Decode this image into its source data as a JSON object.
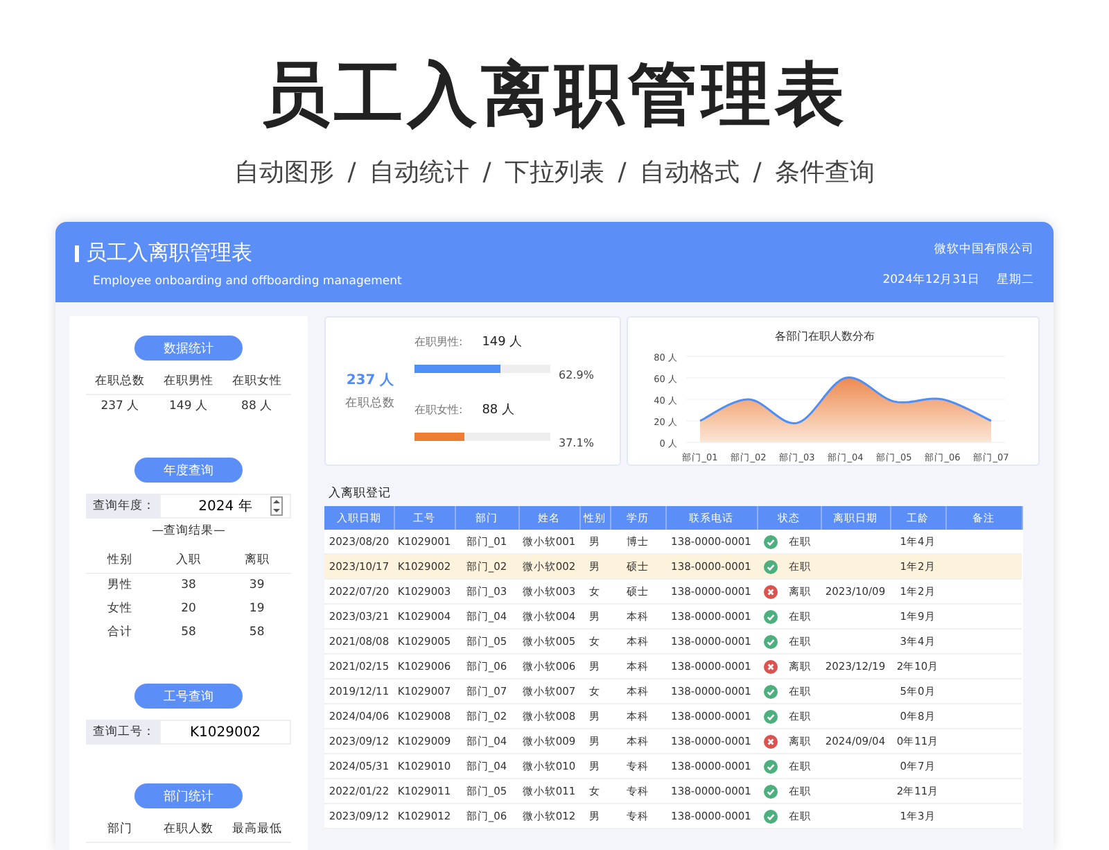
{
  "banner": {
    "title": "员工入离职管理表",
    "subtitle": "自动图形 / 自动统计 / 下拉列表 / 自动格式 / 条件查询"
  },
  "header": {
    "title": "员工入离职管理表",
    "subtitle": "Employee onboarding and offboarding management",
    "company": "微软中国有限公司",
    "date": "2024年12月31日",
    "weekday": "星期二"
  },
  "stats": {
    "button": "数据统计",
    "labels": [
      "在职总数",
      "在职男性",
      "在职女性"
    ],
    "values": [
      "237 人",
      "149 人",
      "88 人"
    ]
  },
  "year_query": {
    "button": "年度查询",
    "label": "查询年度：",
    "value": "2024 年",
    "result_title": "—查询结果—",
    "columns": [
      "性别",
      "入职",
      "离职"
    ],
    "rows": [
      [
        "男性",
        "38",
        "39"
      ],
      [
        "女性",
        "20",
        "19"
      ],
      [
        "合计",
        "58",
        "58"
      ]
    ]
  },
  "id_query": {
    "button": "工号查询",
    "label": "查询工号：",
    "value": "K1029002"
  },
  "dept_stats": {
    "button": "部门统计",
    "columns": [
      "部门",
      "在职人数",
      "最高最低"
    ]
  },
  "summary": {
    "total": "237 人",
    "total_label": "在职总数",
    "bars": [
      {
        "label": "在职男性:",
        "value": "149 人",
        "level": 0.629,
        "percent": "62.9%",
        "color": "#4f8ef7"
      },
      {
        "label": "在职女性:",
        "value": "88 人",
        "level": 0.371,
        "percent": "37.1%",
        "color": "#ed7d31"
      }
    ]
  },
  "chart": {
    "chart_data": {
      "type": "area",
      "title": "各部门在职人数分布",
      "categories": [
        "部门_01",
        "部门_02",
        "部门_03",
        "部门_04",
        "部门_05",
        "部门_06",
        "部门_07"
      ],
      "series": [
        {
          "color": "#4f8ef7",
          "values": [
            20,
            40,
            18,
            60,
            38,
            40,
            20
          ]
        }
      ],
      "grid": true,
      "ylim": [
        0,
        80
      ],
      "yticks": [
        {
          "value": 0,
          "label": "0 人"
        },
        {
          "value": 20,
          "label": "20 人"
        },
        {
          "value": 40,
          "label": "40 人"
        },
        {
          "value": 60,
          "label": "60 人"
        },
        {
          "value": 80,
          "label": "80 人"
        }
      ]
    }
  },
  "register": {
    "title": "入离职登记",
    "columns": [
      "入职日期",
      "工号",
      "部门",
      "姓名",
      "性别",
      "学历",
      "联系电话",
      "状态",
      "离职日期",
      "工龄",
      "备注"
    ],
    "rows": [
      {
        "selected": false,
        "resigned": false,
        "hired": "2023/08/20",
        "id": "K1029001",
        "dept": "部门_01",
        "name": "微小软001",
        "gender": "男",
        "education": "博士",
        "phone": "138-0000-0001",
        "status": "在职",
        "tenure": "1年4月"
      },
      {
        "selected": true,
        "resigned": false,
        "hired": "2023/10/17",
        "id": "K1029002",
        "dept": "部门_02",
        "name": "微小软002",
        "gender": "男",
        "education": "硕士",
        "phone": "138-0000-0001",
        "status": "在职",
        "tenure": "1年2月"
      },
      {
        "selected": false,
        "resigned": true,
        "hired": "2022/07/20",
        "id": "K1029003",
        "dept": "部门_03",
        "name": "微小软003",
        "gender": "女",
        "education": "硕士",
        "phone": "138-0000-0001",
        "status": "离职",
        "leave_date": "2023/10/09",
        "tenure": "1年2月"
      },
      {
        "selected": false,
        "resigned": false,
        "hired": "2023/03/21",
        "id": "K1029004",
        "dept": "部门_04",
        "name": "微小软004",
        "gender": "男",
        "education": "本科",
        "phone": "138-0000-0001",
        "status": "在职",
        "tenure": "1年9月"
      },
      {
        "selected": false,
        "resigned": false,
        "hired": "2021/08/08",
        "id": "K1029005",
        "dept": "部门_05",
        "name": "微小软005",
        "gender": "女",
        "education": "本科",
        "phone": "138-0000-0001",
        "status": "在职",
        "tenure": "3年4月"
      },
      {
        "selected": false,
        "resigned": true,
        "hired": "2021/02/15",
        "id": "K1029006",
        "dept": "部门_06",
        "name": "微小软006",
        "gender": "男",
        "education": "本科",
        "phone": "138-0000-0001",
        "status": "离职",
        "leave_date": "2023/12/19",
        "tenure": "2年10月"
      },
      {
        "selected": false,
        "resigned": false,
        "hired": "2019/12/11",
        "id": "K1029007",
        "dept": "部门_07",
        "name": "微小软007",
        "gender": "女",
        "education": "本科",
        "phone": "138-0000-0001",
        "status": "在职",
        "tenure": "5年0月"
      },
      {
        "selected": false,
        "resigned": false,
        "hired": "2024/04/06",
        "id": "K1029008",
        "dept": "部门_02",
        "name": "微小软008",
        "gender": "男",
        "education": "本科",
        "phone": "138-0000-0001",
        "status": "在职",
        "tenure": "0年8月"
      },
      {
        "selected": false,
        "resigned": true,
        "hired": "2023/09/12",
        "id": "K1029009",
        "dept": "部门_04",
        "name": "微小软009",
        "gender": "男",
        "education": "本科",
        "phone": "138-0000-0001",
        "status": "离职",
        "leave_date": "2024/09/04",
        "tenure": "0年11月"
      },
      {
        "selected": false,
        "resigned": false,
        "hired": "2024/05/31",
        "id": "K1029010",
        "dept": "部门_04",
        "name": "微小软010",
        "gender": "男",
        "education": "专科",
        "phone": "138-0000-0001",
        "status": "在职",
        "tenure": "0年7月"
      },
      {
        "selected": false,
        "resigned": false,
        "hired": "2022/01/22",
        "id": "K1029011",
        "dept": "部门_05",
        "name": "微小软011",
        "gender": "女",
        "education": "专科",
        "phone": "138-0000-0001",
        "status": "在职",
        "tenure": "2年11月"
      },
      {
        "selected": false,
        "resigned": false,
        "hired": "2023/09/12",
        "id": "K1029012",
        "dept": "部门_06",
        "name": "微小软012",
        "gender": "男",
        "education": "专科",
        "phone": "138-0000-0001",
        "status": "在职",
        "tenure": "1年3月"
      }
    ]
  }
}
